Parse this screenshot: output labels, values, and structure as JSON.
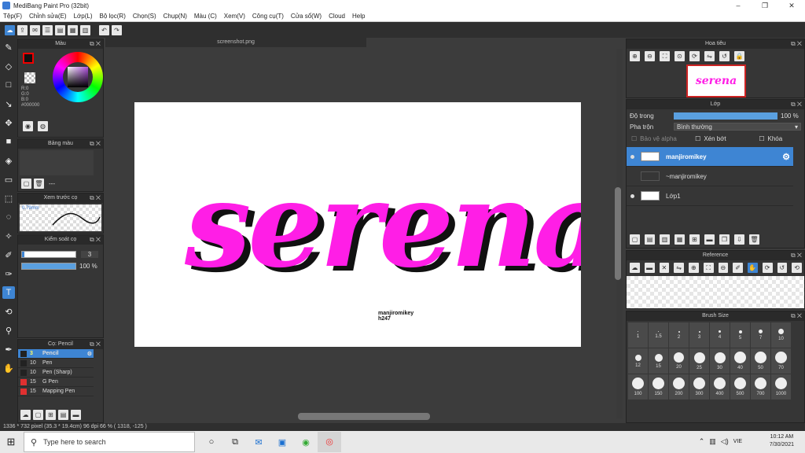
{
  "window": {
    "title": "MediBang Paint Pro (32bit)",
    "minimize": "–",
    "maximize": "❐",
    "close": "✕"
  },
  "menu": [
    "Tệp(F)",
    "Chỉnh sửa(E)",
    "Lớp(L)",
    "Bộ lọc(R)",
    "Chọn(S)",
    "Chụp(N)",
    "Màu (C)",
    "Xem(V)",
    "Công cụ(T)",
    "Cửa sổ(W)",
    "Cloud",
    "Help"
  ],
  "toolbar": {
    "undo": "↶",
    "redo": "↷"
  },
  "color_panel": {
    "title": "Màu",
    "r": "R:0",
    "g": "G:0",
    "b": "B:0",
    "hex": "#000000"
  },
  "palette_panel": {
    "title": "Bảng màu",
    "value": "---"
  },
  "preview_panel": {
    "title": "Xem trước cọ",
    "size": "0.79mm"
  },
  "brush_control": {
    "title": "Kiểm soát cọ",
    "width": "3",
    "opacity": "100 %"
  },
  "brush_list": {
    "title": "Cọ: Pencil",
    "items": [
      {
        "size": "3",
        "name": "Pencil",
        "color": "#222222"
      },
      {
        "size": "10",
        "name": "Pen",
        "color": "#222222"
      },
      {
        "size": "10",
        "name": "Pen (Sharp)",
        "color": "#222222"
      },
      {
        "size": "15",
        "name": "G Pen",
        "color": "#e03030"
      },
      {
        "size": "15",
        "name": "Mapping Pen",
        "color": "#e03030"
      }
    ]
  },
  "canvas": {
    "tab": "screenshot.png",
    "artwork_text": "serena",
    "small_text_1": "manjiromikey",
    "small_text_2": "h247",
    "art_color": "#ff1ee6"
  },
  "navigator": {
    "title": "Hoa tiêu"
  },
  "layer_panel": {
    "title": "Lớp",
    "opacity_label": "Độ trong",
    "opacity_value": "100 %",
    "opacity_fraction": 1.0,
    "blend_label": "Pha trộn",
    "blend_value": "Bình thường",
    "protect_alpha": "Bảo vệ alpha",
    "clipping": "Xén bớt",
    "lock": "Khóa",
    "layers": [
      {
        "name": "manjiromikey",
        "selected": true
      },
      {
        "name": "~manjiromikey",
        "selected": false
      },
      {
        "name": "Lớp1",
        "selected": false
      }
    ]
  },
  "reference_panel": {
    "title": "Reference"
  },
  "brush_size_panel": {
    "title": "Brush Size",
    "sizes": [
      "1",
      "1.5",
      "2",
      "3",
      "4",
      "5",
      "7",
      "10",
      "12",
      "15",
      "20",
      "25",
      "30",
      "40",
      "50",
      "70",
      "100",
      "150",
      "200",
      "300",
      "400",
      "500",
      "700",
      "1000"
    ]
  },
  "status": {
    "text": "1336 * 732 pixel   (35.3 * 19.4cm)   96 dpi   66 %   ( 1318, -125 )"
  },
  "taskbar": {
    "search_placeholder": "Type here to search",
    "time": "10:12 AM",
    "date": "7/30/2021",
    "lang": "VIE"
  }
}
